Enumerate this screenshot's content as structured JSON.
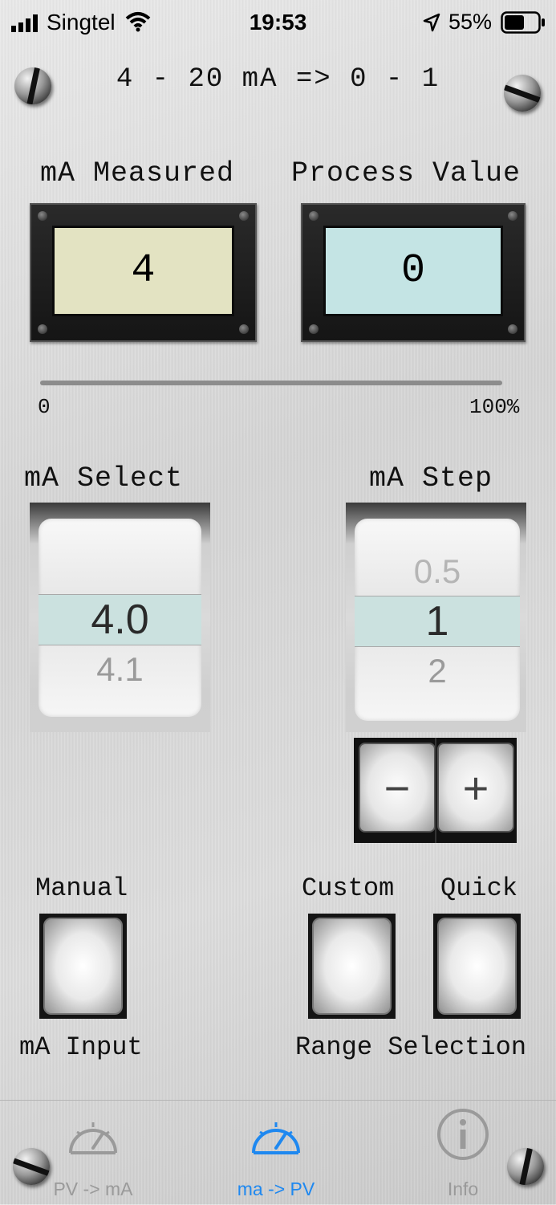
{
  "status_bar": {
    "carrier": "Singtel",
    "time": "19:53",
    "battery": "55%"
  },
  "header": {
    "title": "4 - 20 mA => 0 - 1"
  },
  "meters": {
    "measured": {
      "label": "mA Measured",
      "value": "4"
    },
    "process": {
      "label": "Process Value",
      "value": "0"
    }
  },
  "progress": {
    "min_label": "0",
    "max_label": "100%",
    "value_percent": 0
  },
  "ma_select": {
    "label": "mA Select",
    "above": "",
    "selected": "4.0",
    "below": "4.1"
  },
  "ma_step": {
    "label": "mA Step",
    "above": "0.5",
    "selected": "1",
    "below": "2",
    "minus": "−",
    "plus": "+"
  },
  "buttons": {
    "manual": "Manual",
    "ma_input": "mA Input",
    "custom": "Custom",
    "quick": "Quick",
    "range_selection": "Range Selection"
  },
  "tabs": [
    {
      "label": "PV -> mA",
      "icon": "gauge-icon",
      "active": false
    },
    {
      "label": "ma -> PV",
      "icon": "gauge-icon",
      "active": true
    },
    {
      "label": "Info",
      "icon": "info-icon",
      "active": false
    }
  ],
  "colors": {
    "measured_screen": "#e3e3c2",
    "process_screen": "#c4e4e4",
    "tab_active": "#1e88f0",
    "tab_inactive": "#9a9a9a"
  }
}
